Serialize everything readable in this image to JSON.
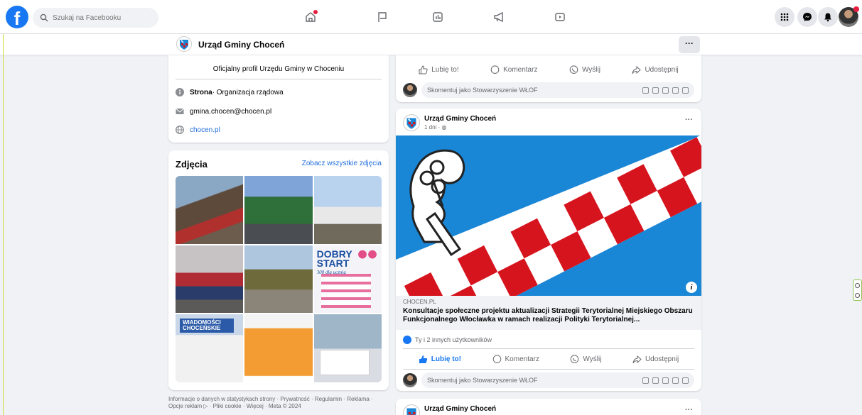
{
  "topbar": {
    "logo": "f",
    "search_placeholder": "Szukaj na Facebooku"
  },
  "page": {
    "name": "Urząd Gminy Choceń",
    "more": "···"
  },
  "intro": {
    "description": "Oficjalny profil Urzędu Gminy w Choceniu",
    "category_strong": "Strona",
    "category_rest": " · Organizacja rządowa",
    "email": "gmina.chocen@chocen.pl",
    "website": "chocen.pl"
  },
  "photos": {
    "heading": "Zdjęcia",
    "see_all": "Zobacz wszystkie zdjęcia",
    "tile6_text": "DOBRY\nSTART",
    "tile6_sub": "300 dla ucznia",
    "tile7_text": "WIADOMOŚCI\nCHOCEŃSKIE"
  },
  "footer": "Informacje o danych w statystykach strony · Prywatność · Regulamin · Reklama · Opcje reklam ▷ · Pliki cookie · Więcej · Meta © 2024",
  "actions": {
    "like": "Lubię to!",
    "comment": "Komentarz",
    "send": "Wyślij",
    "share": "Udostępnij"
  },
  "comment_placeholder": "Skomentuj jako Stowarzyszenie WŁOF",
  "post": {
    "author": "Urząd Gminy Choceń",
    "time": "1 dni · ",
    "more": "···",
    "link_domain": "CHOCEN.PL",
    "link_title": "Konsultacje społeczne projektu aktualizacji Strategii Terytorialnej Miejskiego Obszaru Funkcjonalnego Włocławka w ramach realizacji Polityki Terytorialnej...",
    "reactions": "Ty i 2 innych użytkowników",
    "info_icon": "i"
  },
  "post_next": {
    "author": "Urząd Gminy Choceń",
    "more": "···"
  },
  "colors": {
    "facebook_blue": "#1877f2",
    "flag_red": "#d6141e",
    "flag_blue": "#1a86d6",
    "notification_red": "#e41e3f"
  },
  "icons": [
    "facebook-logo-icon",
    "search-icon",
    "home-icon",
    "flag-icon",
    "dashboard-icon",
    "megaphone-icon",
    "play-icon",
    "menu-grid-icon",
    "messenger-icon",
    "bell-icon"
  ]
}
